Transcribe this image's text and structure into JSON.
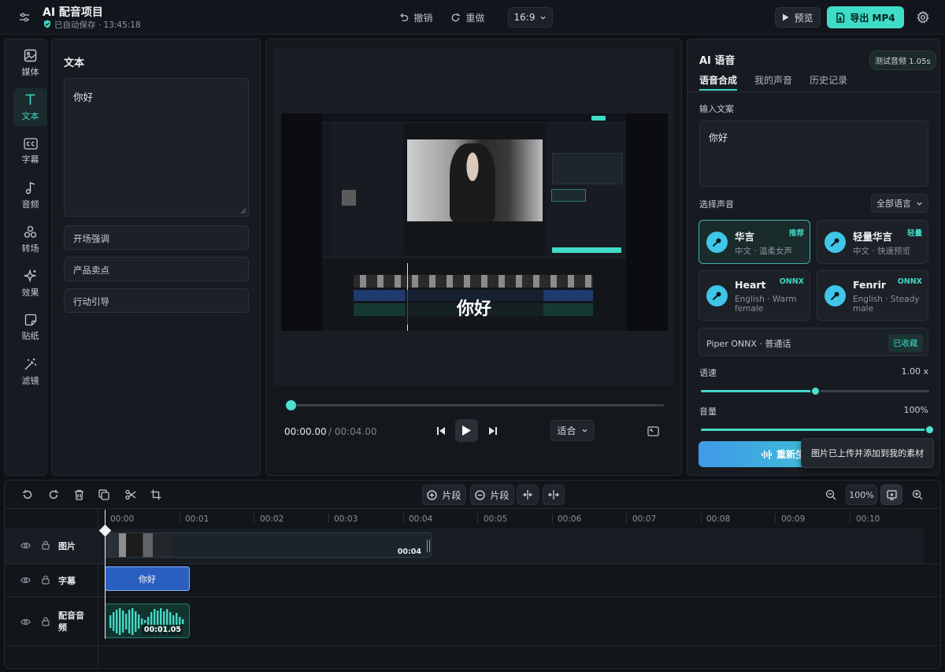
{
  "header": {
    "title": "AI 配音项目",
    "autosave": "已自动保存 · 13:45:18",
    "undo": "撤销",
    "redo": "重做",
    "aspect": "16:9",
    "preview": "预览",
    "export": "导出 MP4"
  },
  "sidebar": {
    "items": [
      {
        "label": "媒体",
        "icon": "image-icon"
      },
      {
        "label": "文本",
        "icon": "text-icon"
      },
      {
        "label": "字幕",
        "icon": "cc-icon"
      },
      {
        "label": "音频",
        "icon": "music-icon"
      },
      {
        "label": "转场",
        "icon": "transition-icon"
      },
      {
        "label": "效果",
        "icon": "sparkle-icon"
      },
      {
        "label": "贴纸",
        "icon": "sticker-icon"
      },
      {
        "label": "滤镜",
        "icon": "magic-wand-icon"
      }
    ]
  },
  "text_panel": {
    "title": "文本",
    "content": "你好",
    "templates": [
      "开场强调",
      "产品卖点",
      "行动引导"
    ]
  },
  "preview": {
    "caption": "你好",
    "current_time": "00:00.00",
    "duration": "/ 00:04.00",
    "fit": "适合",
    "progress": 0.0
  },
  "ai_voice": {
    "title": "AI 语音",
    "test_badge": "测试音频 1.05s",
    "tabs": [
      "语音合成",
      "我的声音",
      "历史记录"
    ],
    "input_label": "输入文案",
    "input_text": "你好",
    "choose_voice_label": "选择声音",
    "lang_filter": "全部语言",
    "voices": [
      {
        "name": "华言",
        "sub": "中文 · 温柔女声",
        "tag": "推荐",
        "selected": true
      },
      {
        "name": "轻量华言",
        "sub": "中文 · 快速预览",
        "tag": "轻量",
        "selected": false
      },
      {
        "name": "Heart",
        "sub": "English · Warm female",
        "tag": "ONNX",
        "selected": false
      },
      {
        "name": "Fenrir",
        "sub": "English · Steady male",
        "tag": "ONNX",
        "selected": false
      }
    ],
    "engine": "Piper ONNX · 普通话",
    "engine_badge": "已收藏",
    "speed_label": "语速",
    "speed_value": "1.00 x",
    "speed_fraction": 0.5,
    "volume_label": "音量",
    "volume_value": "100%",
    "volume_fraction": 1.0,
    "regen_button": "重新生成",
    "toast": "图片已上传并添加到我的素材"
  },
  "timeline": {
    "add_clip": "片段",
    "remove_clip": "片段",
    "zoom": "100%",
    "ticks": [
      "00:00",
      "00:01",
      "00:02",
      "00:03",
      "00:04",
      "00:05",
      "00:06",
      "00:07",
      "00:08",
      "00:09",
      "00:10"
    ],
    "tracks": [
      {
        "label": "图片",
        "clip_time": "00:04"
      },
      {
        "label": "字幕",
        "clip_text": "你好"
      },
      {
        "label": "配音音频",
        "clip_time": "00:01.05"
      }
    ]
  },
  "colors": {
    "accent": "#3fd6c6",
    "background": "#0e1116",
    "panel": "#171b21",
    "caption_clip": "#2a5fc0",
    "export_button": "#3fdcc8"
  }
}
